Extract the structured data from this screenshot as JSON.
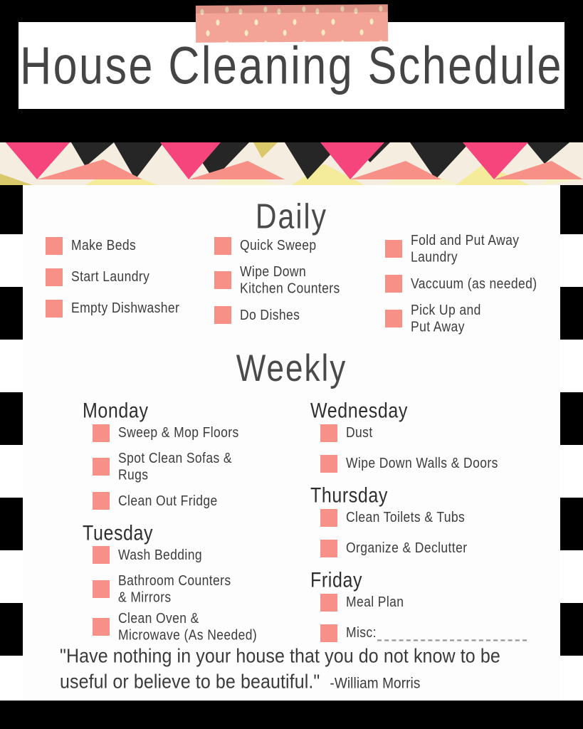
{
  "document": {
    "title": "House Cleaning Schedule",
    "colors": {
      "checkbox": "#F79087",
      "frame": "#000000",
      "washi_tape": "#F4A397",
      "washi_dots": "#F6EAC0",
      "banner_background": "#F5EDE0",
      "banner_pink": "#F5457C",
      "banner_salmon": "#F79087",
      "banner_black": "#262626",
      "banner_yellow": "#F4EC9B",
      "heading_text": "#4A4A4A"
    }
  },
  "daily": {
    "heading": "Daily",
    "columns": [
      {
        "tasks": [
          {
            "label": "Make Beds"
          },
          {
            "label": "Start Laundry"
          },
          {
            "label": "Empty Dishwasher"
          }
        ]
      },
      {
        "tasks": [
          {
            "label": "Quick Sweep"
          },
          {
            "label": "Wipe Down\nKitchen Counters"
          },
          {
            "label": "Do Dishes"
          }
        ]
      },
      {
        "tasks": [
          {
            "label": "Fold and Put Away\nLaundry"
          },
          {
            "label": "Vaccuum (as needed)"
          },
          {
            "label": "Pick Up and\nPut Away"
          }
        ]
      }
    ]
  },
  "weekly": {
    "heading": "Weekly",
    "left_column": [
      {
        "day": "Monday",
        "tasks": [
          {
            "label": "Sweep & Mop Floors"
          },
          {
            "label": "Spot Clean Sofas & Rugs"
          },
          {
            "label": "Clean Out Fridge"
          }
        ]
      },
      {
        "day": "Tuesday",
        "tasks": [
          {
            "label": "Wash Bedding"
          },
          {
            "label": "Bathroom Counters\n& Mirrors"
          },
          {
            "label": "Clean Oven &\nMicrowave (As Needed)"
          }
        ]
      }
    ],
    "right_column": [
      {
        "day": "Wednesday",
        "tasks": [
          {
            "label": "Dust"
          },
          {
            "label": "Wipe Down Walls & Doors"
          }
        ]
      },
      {
        "day": "Thursday",
        "tasks": [
          {
            "label": "Clean Toilets & Tubs"
          },
          {
            "label": "Organize & Declutter"
          }
        ]
      },
      {
        "day": "Friday",
        "tasks": [
          {
            "label": "Meal Plan"
          },
          {
            "label": "Misc:",
            "has_blank_line": true
          }
        ]
      }
    ]
  },
  "quote": {
    "text": "\"Have nothing in your house that you do not know to be useful or believe to be beautiful.\"",
    "attribution": "-William Morris"
  }
}
